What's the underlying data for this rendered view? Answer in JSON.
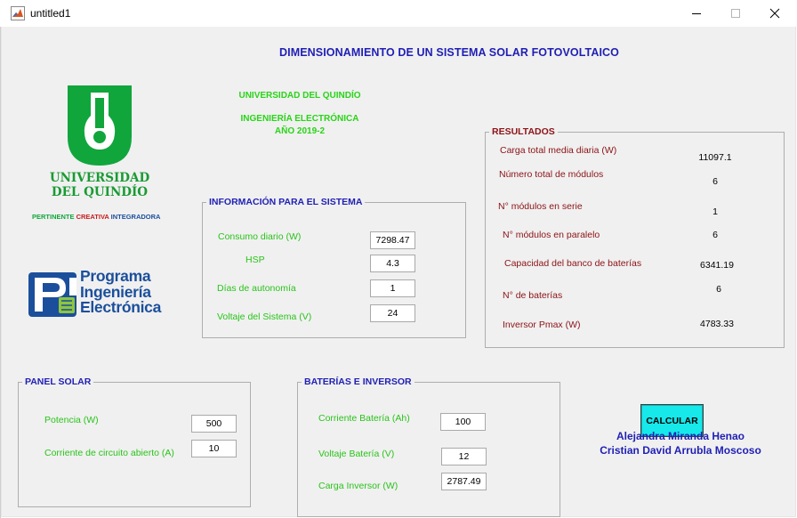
{
  "window": {
    "title": "untitled1"
  },
  "header": {
    "title": "DIMENSIONAMIENTO DE UN SISTEMA SOLAR FOTOVOLTAICO",
    "university": "UNIVERSIDAD DEL QUINDÍO",
    "program": "INGENIERÍA ELECTRÓNICA",
    "year": "AÑO 2019-2"
  },
  "logo_uq": {
    "name_line1": "UNIVERSIDAD",
    "name_line2": "DEL QUINDÍO",
    "tag_1": "PERTINENTE ",
    "tag_2": "CREATIVA ",
    "tag_3": "INTEGRADORA",
    "color": "#10a63c"
  },
  "logo_program": {
    "line1": "Programa",
    "line2": "Ingeniería",
    "line3": "Electrónica",
    "color": "#1b4f9c"
  },
  "system_info": {
    "title": "INFORMACIÓN PARA EL SISTEMA",
    "consumo_label": "Consumo diario (W)",
    "consumo_value": "7298.47",
    "hsp_label": "HSP",
    "hsp_value": "4.3",
    "autonomia_label": "Días de autonomía",
    "autonomia_value": "1",
    "voltaje_label": "Voltaje del Sistema (V)",
    "voltaje_value": "24"
  },
  "results": {
    "title": "RESULTADOS",
    "carga_label": "Carga total media diaria (W)",
    "carga_value": "11097.1",
    "modulos_label": "Número total de módulos",
    "modulos_value": "6",
    "serie_label": "N° módulos en serie",
    "serie_value": "1",
    "paralelo_label": "N° módulos en paralelo",
    "paralelo_value": "6",
    "capacidad_label": "Capacidad del banco de baterías",
    "capacidad_value": "6341.19",
    "baterias_label": "N° de baterías",
    "baterias_value": "6",
    "inversor_label": "Inversor Pmax (W)",
    "inversor_value": "4783.33"
  },
  "panel": {
    "title": "PANEL SOLAR",
    "potencia_label": "Potencia (W)",
    "potencia_value": "500",
    "corriente_label": "Corriente de circuito abierto (A)",
    "corriente_value": "10"
  },
  "battery": {
    "title": "BATERÍAS E INVERSOR",
    "corriente_label": "Corriente  Batería (Ah)",
    "corriente_value": "100",
    "voltaje_label": "Voltaje  Batería (V)",
    "voltaje_value": "12",
    "carga_label": "Carga Inversor (W)",
    "carga_value": "2787.49"
  },
  "actions": {
    "calcular": "CALCULAR"
  },
  "authors": {
    "author1": "Alejandra Miranda Henao",
    "author2": "Cristian David Arrubla Moscoso"
  },
  "colors": {
    "title_blue": "#1f1fb5",
    "label_green": "#29c41a",
    "result_red": "#8c1216",
    "button_cyan": "#17e8ea"
  }
}
